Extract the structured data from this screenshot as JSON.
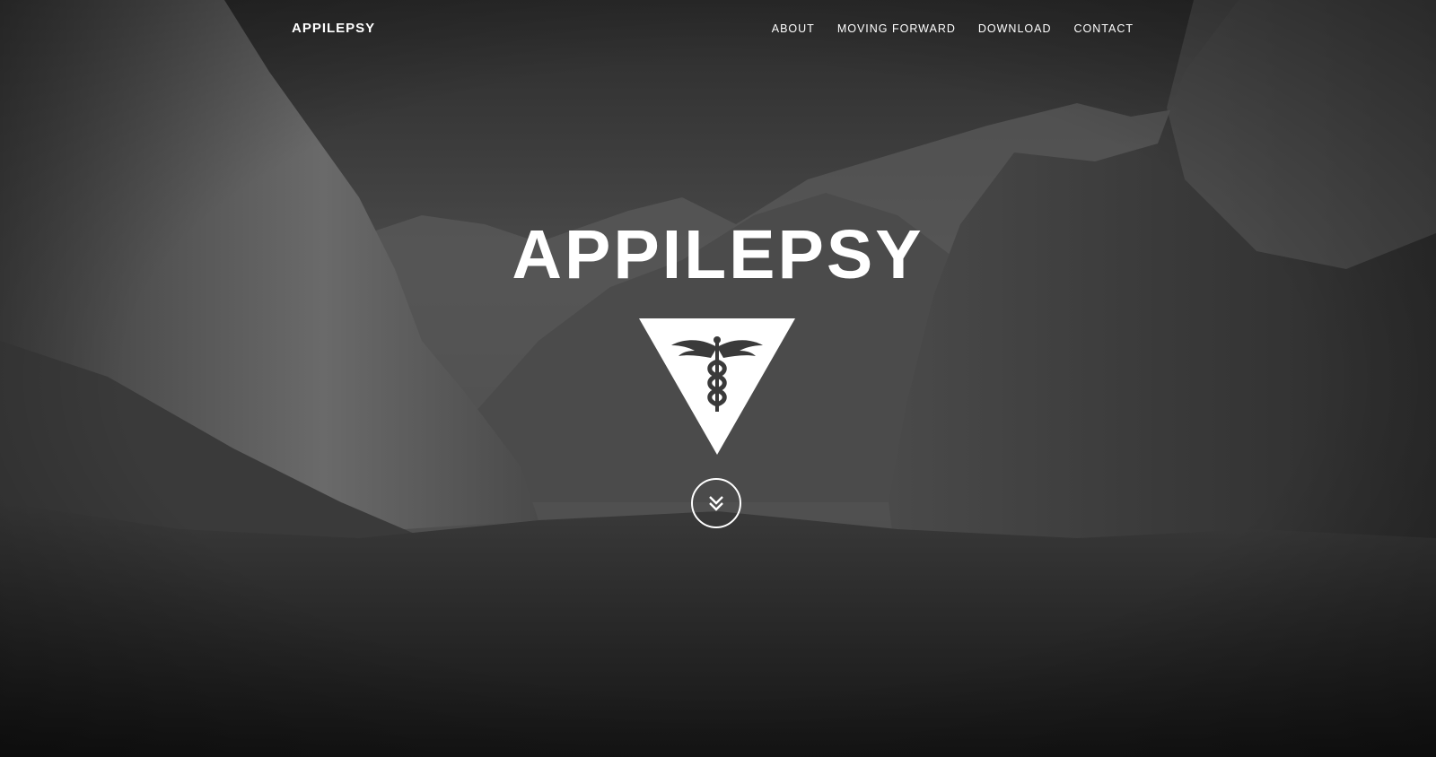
{
  "nav": {
    "brand": "APPILEPSY",
    "links": [
      {
        "label": "ABOUT"
      },
      {
        "label": "MOVING FORWARD"
      },
      {
        "label": "DOWNLOAD"
      },
      {
        "label": "CONTACT"
      }
    ]
  },
  "hero": {
    "title": "APPILEPSY",
    "logo_icon": "caduceus-triangle-icon",
    "scroll_icon": "double-chevron-down-icon"
  },
  "colors": {
    "text": "#ffffff",
    "background": "#2a2a2a"
  }
}
